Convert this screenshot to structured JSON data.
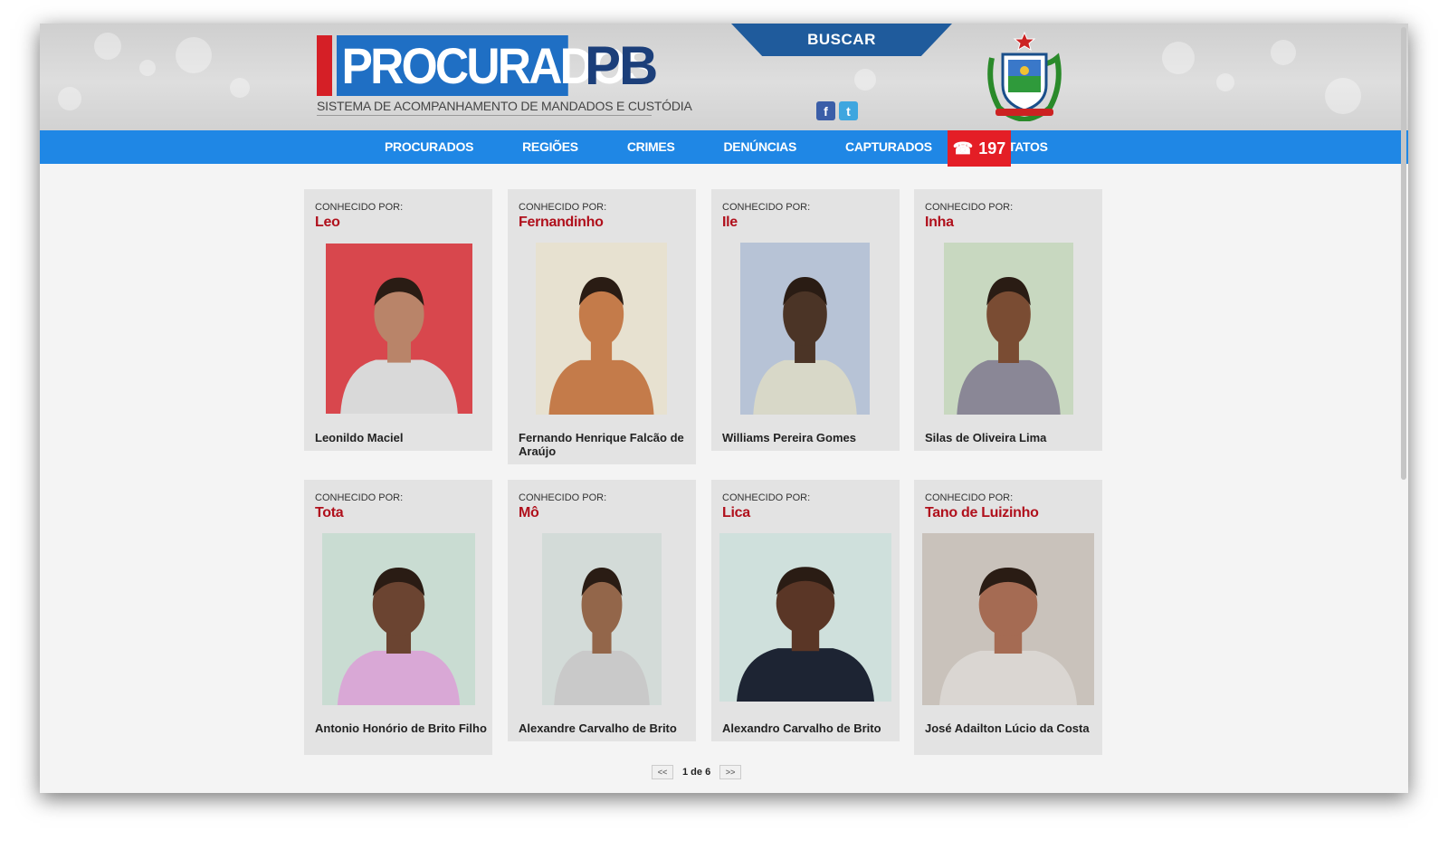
{
  "header": {
    "logo_main": "PROCURADOS",
    "logo_suffix": "PB",
    "logo_subtitle": "SISTEMA DE ACOMPANHAMENTO DE MANDADOS E CUSTÓDIA",
    "search_label": "BUSCAR",
    "social": {
      "facebook": "f",
      "twitter": "t"
    }
  },
  "nav": {
    "items": [
      "PROCURADOS",
      "REGIÕES",
      "CRIMES",
      "DENÚNCIAS",
      "CAPTURADOS",
      "CONTATOS"
    ],
    "phone_icon": "☎",
    "phone_number": "197"
  },
  "known_as_label": "CONHECIDO POR:",
  "cards": [
    {
      "nickname": "Leo",
      "name": "Leonildo Maciel",
      "photo": {
        "bg": "#d8474d",
        "skin": "#b98469",
        "shirt": "#d9d9d9"
      }
    },
    {
      "nickname": "Fernandinho",
      "name": "Fernando Henrique Falcão de Araújo",
      "photo": {
        "bg": "#e7e1d0",
        "skin": "#c47b4a",
        "shirt": "#c47b4a"
      }
    },
    {
      "nickname": "Ile",
      "name": "Williams Pereira Gomes",
      "photo": {
        "bg": "#b7c3d6",
        "skin": "#4b3426",
        "shirt": "#d8d8c8"
      }
    },
    {
      "nickname": "Inha",
      "name": "Silas de Oliveira Lima",
      "photo": {
        "bg": "#c8d8c0",
        "skin": "#7a4c33",
        "shirt": "#8a8796"
      }
    },
    {
      "nickname": "Tota",
      "name": "Antonio Honório de Brito Filho",
      "photo": {
        "bg": "#c9dcd2",
        "skin": "#6b4431",
        "shirt": "#d9a8d6"
      }
    },
    {
      "nickname": "Mô",
      "name": "Alexandre Carvalho de Brito",
      "photo": {
        "bg": "#d3dbd8",
        "skin": "#93664a",
        "shirt": "#c9c9c9"
      }
    },
    {
      "nickname": "Lica",
      "name": "Alexandro Carvalho de Brito",
      "photo": {
        "bg": "#cfe0dc",
        "skin": "#5a3626",
        "shirt": "#1d2433"
      }
    },
    {
      "nickname": "Tano de Luizinho",
      "name": "José Adailton Lúcio da Costa",
      "photo": {
        "bg": "#c9c2bb",
        "skin": "#a56b53",
        "shirt": "#dad6d2"
      }
    }
  ],
  "pagination": {
    "prev": "<<",
    "next": ">>",
    "label": "1 de 6"
  }
}
